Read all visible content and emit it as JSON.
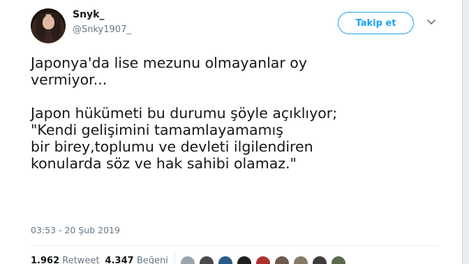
{
  "user": {
    "display_name": "Snyk_",
    "handle": "@Snky1907_"
  },
  "follow_button": {
    "label": "Takip et"
  },
  "tweet": {
    "text": "Japonya'da lise mezunu olmayanlar oy\nvermiyor...\n\nJapon hükümeti bu durumu şöyle açıklıyor;\n\"Kendi gelişimini tamamlayamamış\nbir birey,toplumu ve devleti ilgilendiren\nkonularda söz ve hak sahibi olamaz.\"",
    "timestamp": "03:53 - 20 Şub 2019"
  },
  "stats": {
    "retweets_count": "1.962",
    "retweets_label": "Retweet",
    "likes_count": "4.347",
    "likes_label": "Beğeni"
  },
  "likers": [
    {
      "name": "liker-avatar",
      "color": "#9aa5ad"
    },
    {
      "name": "liker-avatar",
      "color": "#4a4a4a"
    },
    {
      "name": "liker-avatar",
      "color": "#2c5c8a"
    },
    {
      "name": "liker-avatar",
      "color": "#1f1f1f"
    },
    {
      "name": "liker-avatar",
      "color": "#b03030"
    },
    {
      "name": "liker-avatar",
      "color": "#6d5a4e"
    },
    {
      "name": "liker-avatar",
      "color": "#8a7a6a"
    },
    {
      "name": "liker-avatar",
      "color": "#3d3d3d"
    },
    {
      "name": "liker-avatar",
      "color": "#5a6a4a"
    }
  ],
  "colors": {
    "accent": "#1da1f2",
    "text_primary": "#14171a",
    "text_secondary": "#657786"
  }
}
